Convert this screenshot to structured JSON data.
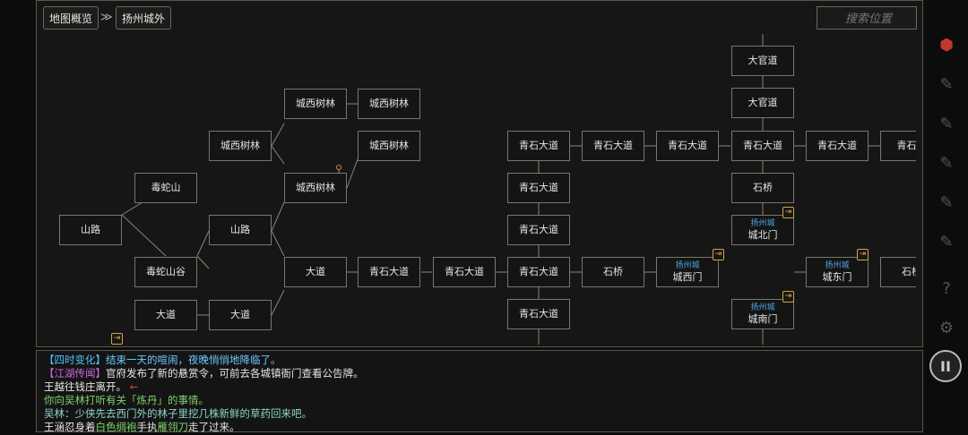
{
  "breadcrumb": {
    "root": "地图概览",
    "separator": "≫",
    "current": "扬州城外"
  },
  "search": {
    "placeholder": "搜索位置"
  },
  "nodes": [
    {
      "id": "n1",
      "label": "山路"
    },
    {
      "id": "n2",
      "label": "毒蛇山"
    },
    {
      "id": "n3",
      "label": "毒蛇山谷"
    },
    {
      "id": "n4",
      "label": "大道"
    },
    {
      "id": "n5",
      "label": "大道"
    },
    {
      "id": "n6",
      "label": "城西树林"
    },
    {
      "id": "n7",
      "label": "山路"
    },
    {
      "id": "n8",
      "label": "城西树林"
    },
    {
      "id": "n9",
      "label": "城西树林"
    },
    {
      "id": "n10",
      "label": "大道"
    },
    {
      "id": "n11",
      "label": "城西树林"
    },
    {
      "id": "n12",
      "label": "城西树林"
    },
    {
      "id": "n13",
      "label": "青石大道"
    },
    {
      "id": "n14",
      "label": "青石大道"
    },
    {
      "id": "n15",
      "label": "青石大道"
    },
    {
      "id": "n16",
      "label": "青石大道"
    },
    {
      "id": "n17",
      "label": "青石大道"
    },
    {
      "id": "n18",
      "label": "青石大道"
    },
    {
      "id": "n19",
      "label": "青石大道"
    },
    {
      "id": "n20",
      "label": "石桥"
    },
    {
      "id": "n21",
      "label": "青石大道"
    },
    {
      "id": "n22",
      "label": "城西门",
      "sub": "扬州城"
    },
    {
      "id": "n23",
      "label": "大官道"
    },
    {
      "id": "n24",
      "label": "大官道"
    },
    {
      "id": "n25",
      "label": "青石大道"
    },
    {
      "id": "n26",
      "label": "石桥"
    },
    {
      "id": "n27",
      "label": "城北门",
      "sub": "扬州城"
    },
    {
      "id": "n28",
      "label": "城南门",
      "sub": "扬州城"
    },
    {
      "id": "n29",
      "label": "青石大道"
    },
    {
      "id": "n30",
      "label": "城东门",
      "sub": "扬州城"
    },
    {
      "id": "n31",
      "label": "青石大"
    },
    {
      "id": "n32",
      "label": "石桥"
    }
  ],
  "log": [
    {
      "parts": [
        {
          "t": "【四时变化】",
          "c": "tag-y"
        },
        {
          "t": "结束一天的喧闹，夜晚悄悄地降临了。",
          "c": "hl-b"
        }
      ]
    },
    {
      "parts": [
        {
          "t": "【江湖传闻】",
          "c": "tag-p"
        },
        {
          "t": "官府发布了新的悬赏令，可前去各城镇衙门查看公告牌。",
          "c": "txt-w"
        }
      ]
    },
    {
      "parts": [
        {
          "t": "王越往钱庄离开。",
          "c": "txt-w"
        },
        {
          "t": " ←",
          "c": "arrow-red"
        }
      ]
    },
    {
      "parts": [
        {
          "t": "你向吴林打听有关「",
          "c": "hl-g"
        },
        {
          "t": "炼丹",
          "c": "hl-g"
        },
        {
          "t": "」的事情。",
          "c": "hl-g"
        }
      ]
    },
    {
      "parts": [
        {
          "t": "吴林：少侠先去西门外的林子里挖几株新鲜的草药回来吧。",
          "c": "txt-g"
        }
      ]
    },
    {
      "parts": [
        {
          "t": "王涵忍身着",
          "c": "txt-w"
        },
        {
          "t": "白色绸袍",
          "c": "hl-g"
        },
        {
          "t": "手执",
          "c": "txt-w"
        },
        {
          "t": "雁翎刀",
          "c": "hl-g"
        },
        {
          "t": "走了过来。",
          "c": "txt-w"
        }
      ]
    }
  ],
  "sidebar": {
    "items": [
      "back-icon",
      "skill-icon",
      "bag-icon",
      "craft-icon",
      "team-icon",
      "quest-icon",
      "help-icon",
      "settings-icon"
    ]
  },
  "pause": {
    "label": "II"
  },
  "colors": {
    "accent": "#c9a650",
    "city_label": "#4fa3e0",
    "border": "#5a5648"
  }
}
